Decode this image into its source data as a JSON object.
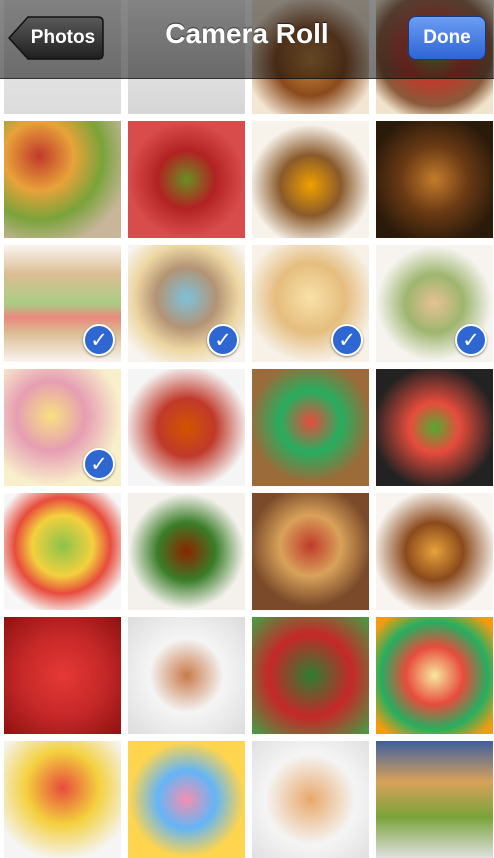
{
  "navbar": {
    "title": "Camera Roll",
    "back_label": "Photos",
    "done_label": "Done"
  },
  "photos": [
    {
      "name": "photo-screenshot-ads",
      "bg": "linear-gradient(#eeeeee,#dcdcdc)",
      "selected": false
    },
    {
      "name": "photo-screenshot-ads-2",
      "bg": "linear-gradient(#f2f2f2,#d6d6d6)",
      "selected": false
    },
    {
      "name": "photo-cheeseburger",
      "bg": "radial-gradient(circle at 50% 55%,#c98a3a 0%,#8b4a1c 40%,#f3e6d3 75%)",
      "selected": false
    },
    {
      "name": "photo-salad-pot",
      "bg": "radial-gradient(circle at 50% 45%,#5fa83a 0%,#c0392b 35%,#8a5a3a 65%,#f1e4cc 85%)",
      "selected": false
    },
    {
      "name": "photo-food-spread",
      "bg": "radial-gradient(circle at 30% 30%,#c0392b 0%,#e8a23a 30%,#7aa33a 55%,#c8b59a 80%)",
      "selected": false
    },
    {
      "name": "photo-vegetable-face",
      "bg": "radial-gradient(circle at 50% 50%,#6b8e23 0%,#b22222 35%,#d94c4c 70%)",
      "selected": false
    },
    {
      "name": "photo-food-pyramid",
      "bg": "radial-gradient(circle at 50% 55%,#f0a000 0%,#8a5a2b 35%,#f7f2ea 70%)",
      "selected": false
    },
    {
      "name": "photo-buffet-dishes",
      "bg": "radial-gradient(circle at 50% 50%,#c47c2c 0%,#6b3a14 40%,#2a1a0a 80%)",
      "selected": false
    },
    {
      "name": "photo-sandwich",
      "bg": "linear-gradient(#f6efe6 0%,#c99a5a 25%,#7cb342 50%,#e04a3a 62%,#c99a5a 75%,#f6efe6 100%)",
      "selected": true
    },
    {
      "name": "photo-tea-dishes",
      "bg": "radial-gradient(circle at 50% 45%,#3aa0c8 0%,#8b5a2b 35%,#e3c070 60%,#f4efe8 85%)",
      "selected": true
    },
    {
      "name": "photo-pancakes",
      "bg": "radial-gradient(circle at 50% 45%,#f6d27a 0%,#d89a3a 40%,#f3eadb 75%)",
      "selected": true
    },
    {
      "name": "photo-fish-dish",
      "bg": "radial-gradient(circle at 50% 50%,#d9a25a 0%,#6b8e23 35%,#f3efe9 70%)",
      "selected": true
    },
    {
      "name": "photo-fruit",
      "bg": "radial-gradient(circle at 40% 40%,#f4d03f 0%,#d96a8a 35%,#f5e6b0 70%)",
      "selected": true
    },
    {
      "name": "photo-kebabs",
      "bg": "radial-gradient(circle at 50% 50%,#d35400 0%,#c0392b 35%,#f5f5f5 75%)",
      "selected": false
    },
    {
      "name": "photo-vegetable-basket",
      "bg": "radial-gradient(circle at 50% 45%,#e74c3c 0%,#27ae60 35%,#9b6b3a 70%)",
      "selected": false
    },
    {
      "name": "photo-salad-bowl",
      "bg": "radial-gradient(circle at 50% 50%,#58a832 0%,#e74c3c 30%,#222222 75%)",
      "selected": false
    },
    {
      "name": "photo-fruit-bowl",
      "bg": "radial-gradient(circle at 50% 45%,#8bc34a 0%,#f4d03f 35%,#e74c3c 55%,#f7f7f7 80%)",
      "selected": false
    },
    {
      "name": "photo-steak",
      "bg": "radial-gradient(circle at 50% 50%,#8b2500 0%,#3a7d28 35%,#f4f1ec 70%)",
      "selected": false
    },
    {
      "name": "photo-sandwiches",
      "bg": "radial-gradient(circle at 50% 45%,#c0392b 0%,#d9a25a 35%,#7a4a2a 70%)",
      "selected": false
    },
    {
      "name": "photo-burger-fries",
      "bg": "radial-gradient(circle at 50% 50%,#e8a23a 0%,#8b4a1c 35%,#f8f4ef 75%)",
      "selected": false
    },
    {
      "name": "photo-strawberries",
      "bg": "radial-gradient(circle at 50% 50%,#e53935 0%,#c62828 50%,#8e1111 100%)",
      "selected": false
    },
    {
      "name": "photo-plated-dish",
      "bg": "radial-gradient(circle at 50% 50%,#c97a4a 0%,#f5f5f5 45%,#dcdcdc 100%)",
      "selected": false
    },
    {
      "name": "photo-peppers",
      "bg": "radial-gradient(circle at 50% 50%,#2e7d32 0%,#c62828 50%,#43a047 100%)",
      "selected": false
    },
    {
      "name": "photo-fruit-mix",
      "bg": "radial-gradient(circle at 50% 50%,#f9e79f 0%,#e74c3c 35%,#27ae60 65%,#f39c12 90%)",
      "selected": false
    },
    {
      "name": "photo-pasta",
      "bg": "radial-gradient(circle at 50% 40%,#e74c3c 0%,#f4d03f 40%,#f5f5f5 80%)",
      "selected": false
    },
    {
      "name": "photo-candy",
      "bg": "radial-gradient(circle at 50% 50%,#f48fb1 0%,#64b5f6 35%,#ffd54f 70%)",
      "selected": false
    },
    {
      "name": "photo-dessert",
      "bg": "radial-gradient(circle at 50% 50%,#e8a86a 0%,#f5f5f5 55%,#e0e0e0 100%)",
      "selected": false
    },
    {
      "name": "photo-screenshot-grid",
      "bg": "linear-gradient(#3e5e9e 0%,#d9a25a 35%,#7aa33a 65%,#e0e0e0 100%)",
      "selected": false
    }
  ]
}
